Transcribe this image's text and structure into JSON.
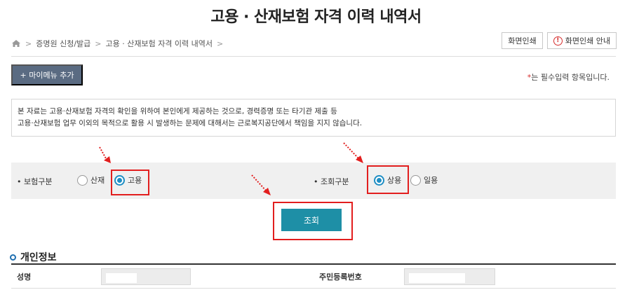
{
  "page": {
    "title": "고용 · 산재보험 자격 이력 내역서"
  },
  "breadcrumb": {
    "items": [
      "증명원 신청/발급",
      "고용 · 산재보험 자격 이력 내역서"
    ],
    "separator": ">"
  },
  "toolbar": {
    "print_label": "화면인쇄",
    "print_guide_label": "화면인쇄 안내"
  },
  "my_menu_button": "+ 마이메뉴 추가",
  "required_note": {
    "star": "*",
    "text": "는 필수입력 항목입니다."
  },
  "notice": {
    "line1": "본 자료는 고용·산재보험 자격의 확인을 위하여 본인에게 제공하는 것으로, 경력증명 또는 타기관 제출 등",
    "line2": "고용·산재보험 업무 이외의 목적으로 활용 시 발생하는 문제에 대해서는 근로복지공단에서 책임을 지지 않습니다."
  },
  "insurance_type": {
    "label": "• 보험구분",
    "options": [
      {
        "label": "산재",
        "selected": false
      },
      {
        "label": "고용",
        "selected": true
      }
    ]
  },
  "inquiry_type": {
    "label": "• 조회구분",
    "options": [
      {
        "label": "상용",
        "selected": true
      },
      {
        "label": "일용",
        "selected": false
      }
    ]
  },
  "search_button": "조회",
  "personal_info": {
    "section_title": "개인정보",
    "name_label": "성명",
    "resident_number_label": "주민등록번호"
  },
  "colors": {
    "accent": "#1e8fa6",
    "radio_selected": "#1f8ec4",
    "highlight_box": "#e21e1e",
    "my_menu_bg": "#5a6b82"
  }
}
